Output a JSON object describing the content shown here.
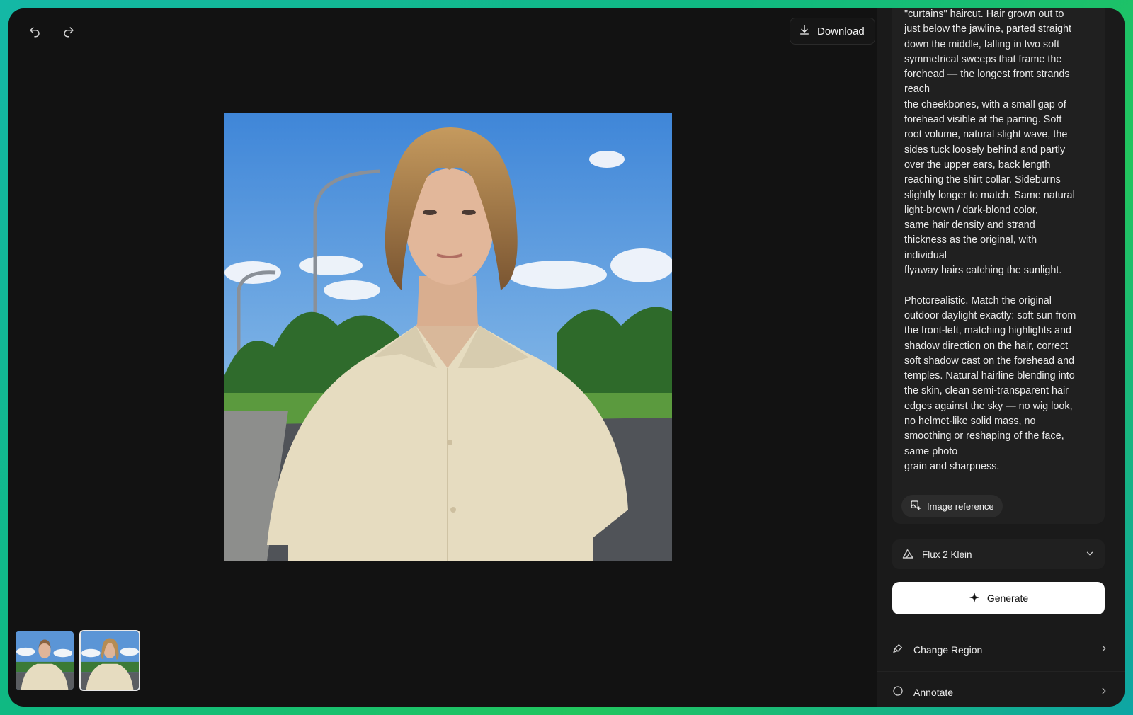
{
  "toolbar": {
    "undo_icon": "undo-icon",
    "redo_icon": "redo-icon",
    "download_label": "Download"
  },
  "canvas": {
    "thumbnails": [
      {
        "name": "original"
      },
      {
        "name": "edited",
        "active": true
      }
    ]
  },
  "panel": {
    "prompt": "\"curtains\" haircut. Hair grown out to\njust below the jawline, parted straight\ndown the middle, falling in two soft\nsymmetrical sweeps that frame the\nforehead — the longest front strands\nreach\nthe cheekbones, with a small gap of\nforehead visible at the parting. Soft\nroot volume, natural slight wave, the\nsides tuck loosely behind and partly\nover the upper ears, back length\nreaching the shirt collar. Sideburns\nslightly longer to match. Same natural\nlight-brown / dark-blond color,\nsame hair density and strand\nthickness as the original, with\nindividual\nflyaway hairs catching the sunlight.\n\nPhotorealistic. Match the original\noutdoor daylight exactly: soft sun from\nthe front-left, matching highlights and\nshadow direction on the hair, correct\nsoft shadow cast on the forehead and\ntemples. Natural hairline blending into\nthe skin, clean semi-transparent hair\nedges against the sky — no wig look,\nno helmet-like solid mass, no\nsmoothing or reshaping of the face,\nsame photo\ngrain and sharpness.",
    "image_reference_label": "Image reference",
    "model": "Flux 2 Klein",
    "generate_label": "Generate",
    "tools": [
      {
        "label": "Change Region",
        "icon": "brush-icon"
      },
      {
        "label": "Annotate",
        "icon": "annotate-icon"
      }
    ]
  },
  "colors": {
    "background": "#121212",
    "panel": "#1a1a1a",
    "card": "#202020",
    "generate_bg": "#ffffff",
    "frame_gradient": "#14b8a6"
  }
}
